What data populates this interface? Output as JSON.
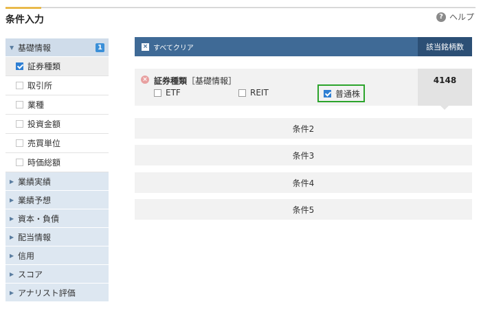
{
  "header": {
    "title": "条件入力",
    "help_label": "ヘルプ",
    "help_glyph": "?"
  },
  "sidebar": {
    "groups": [
      {
        "label": "基礎情報",
        "badge": "1",
        "open": true,
        "items": [
          {
            "label": "証券種類",
            "checked": true
          },
          {
            "label": "取引所",
            "checked": false
          },
          {
            "label": "業種",
            "checked": false
          },
          {
            "label": "投資金額",
            "checked": false
          },
          {
            "label": "売買単位",
            "checked": false
          },
          {
            "label": "時価総額",
            "checked": false
          }
        ]
      },
      {
        "label": "業績実績"
      },
      {
        "label": "業績予想"
      },
      {
        "label": "資本・負債"
      },
      {
        "label": "配当情報"
      },
      {
        "label": "信用"
      },
      {
        "label": "スコア"
      },
      {
        "label": "アナリスト評価"
      }
    ]
  },
  "toolbar": {
    "clear_label": "すべてクリア",
    "clear_glyph": "×"
  },
  "results": {
    "header": "該当銘柄数",
    "count": "4148"
  },
  "condition1": {
    "title": "証券種類",
    "category": "［基礎情報］",
    "error_glyph": "×",
    "options": [
      {
        "label": "ETF",
        "checked": false
      },
      {
        "label": "REIT",
        "checked": false
      },
      {
        "label": "普通株",
        "checked": true
      }
    ]
  },
  "conditions": [
    "条件2",
    "条件3",
    "条件4",
    "条件5"
  ],
  "colors": {
    "accent": "#3f6a96",
    "header_dark": "#2c4f75",
    "highlight": "#2aa32a",
    "badge": "#3a8fd8"
  }
}
